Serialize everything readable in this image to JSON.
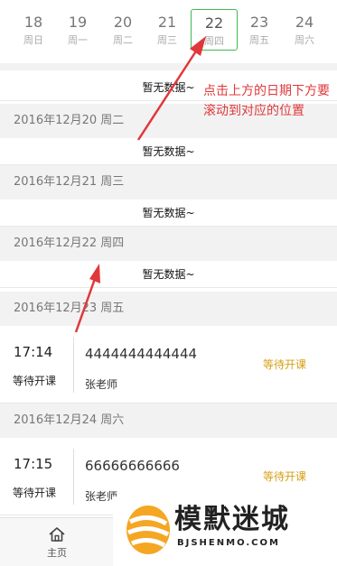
{
  "date_bar": {
    "days": [
      {
        "num": "18",
        "weekday": "周日"
      },
      {
        "num": "19",
        "weekday": "周一"
      },
      {
        "num": "20",
        "weekday": "周二"
      },
      {
        "num": "21",
        "weekday": "周三"
      },
      {
        "num": "22",
        "weekday": "周四"
      },
      {
        "num": "23",
        "weekday": "周五"
      },
      {
        "num": "24",
        "weekday": "周六"
      }
    ],
    "selected": "22",
    "accent": "#3fb950"
  },
  "empty_text": "暂无数据~",
  "sections": [
    {
      "header": "2016年12月20 周二"
    },
    {
      "header": "2016年12月21 周三"
    },
    {
      "header": "2016年12月22 周四"
    },
    {
      "header": "2016年12月23 周五"
    },
    {
      "header": "2016年12月24 周六"
    }
  ],
  "courses": [
    {
      "time": "17:14",
      "state": "等待开课",
      "code": "4444444444444",
      "teacher": "张老师",
      "status": "等待开课"
    },
    {
      "time": "17:15",
      "state": "等待开课",
      "code": "66666666666",
      "teacher": "张老师",
      "status": "等待开课"
    }
  ],
  "annotation": "点击上方的日期下方要滚动到对应的位置",
  "annotation_color": "#e0383a",
  "status_color": "#d4a017",
  "tab_bar": {
    "home_label": "主页",
    "home_icon": "home-icon"
  },
  "watermark": {
    "title": "模默迷城",
    "subtitle": "BJSHENMO.COM"
  }
}
